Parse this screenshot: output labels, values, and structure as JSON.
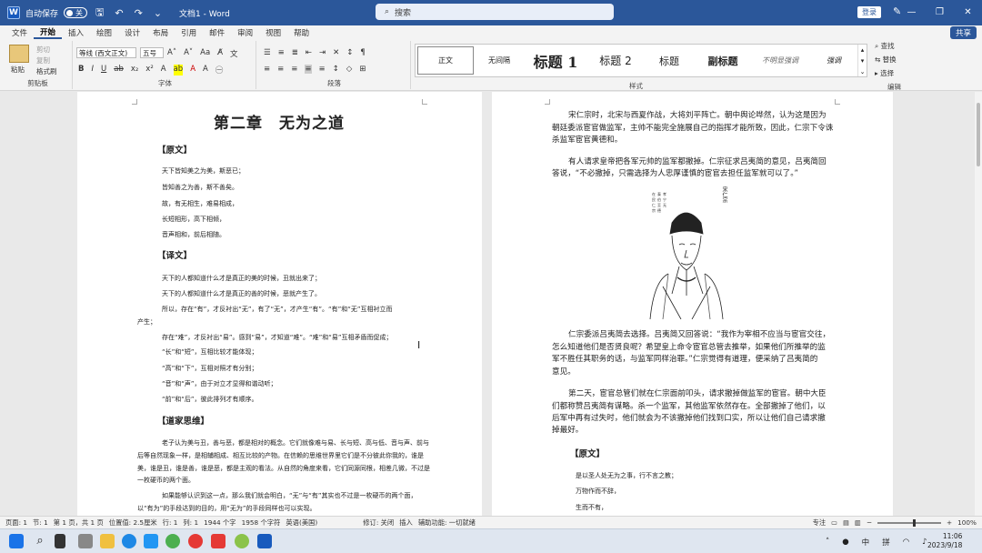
{
  "titlebar": {
    "autosave_label": "自动保存",
    "autosave_state": "关",
    "doc_title": "文档1 - Word",
    "search_placeholder": "搜索",
    "login_label": "登录",
    "minimize": "—",
    "restore": "❐",
    "close": "✕"
  },
  "tabs": [
    "文件",
    "开始",
    "插入",
    "绘图",
    "设计",
    "布局",
    "引用",
    "邮件",
    "审阅",
    "视图",
    "帮助"
  ],
  "share_label": "共享",
  "ribbon": {
    "clipboard": {
      "paste": "粘贴",
      "cut": "剪切",
      "copy": "复制",
      "format_painter": "格式刷",
      "label": "剪贴板"
    },
    "font": {
      "font_name": "等线 (西文正文)",
      "font_size": "五号",
      "label": "字体"
    },
    "paragraph": {
      "label": "段落"
    },
    "styles": {
      "items": [
        "正文",
        "无间隔",
        "标题 1",
        "标题 2",
        "标题",
        "副标题",
        "不明显强调",
        "强调"
      ],
      "label": "样式"
    },
    "editing": {
      "find": "查找",
      "replace": "替换",
      "select": "选择",
      "label": "编辑"
    }
  },
  "page1": {
    "chapter_title": "第二章　无为之道",
    "section_yuanwen": "【原文】",
    "yuanwen_lines": [
      "天下皆知美之为美，斯恶已；",
      "皆知善之为善，斯不善矣。",
      "故，有无相生，难易相成，",
      "长短相形，高下相倾，",
      "音声相和，前后相随。"
    ],
    "section_yiwen": "【译文】",
    "yiwen_lines": [
      "天下的人都知道什么才是真正的美的时候，丑就出来了；",
      "天下的人都知道什么才是真正的善的时候，恶就产生了。",
      "所以，存在“有”，才反衬出“无”，有了“无”，才产生“有”。“有”和“无”互相衬立而",
      "产生；",
      "存在“难”，才反衬出“易”。感到“易”，才知道“难”。“难”和“易”互相矛盾而促成；",
      "“长”和“短”，互相比较才能体现；",
      "“高”和“下”，互相对照才有分别；",
      "“音”和“声”，由于对立才显得和谐动听；",
      "“前”和“后”，彼此排列才有顺序。"
    ],
    "section_sixiang": "【道家思维】",
    "sixiang_lines": [
      "老子认为美与丑，善与恶，都是相对的概念。它们就像难与易、长与短、高与低、音与声、前与",
      "后等自然现象一样，是相辅相成、相互比较的产物。在信赖的思维世界里它们是不分彼此你我的，谁是",
      "美，谁是丑，谁是善，谁是恶，都是主观的看法。从自然的角度来看，它们同源同根，相差几微，不过是",
      "一枚硬币的两个面。",
      "如果能够认识到这一点，那么我们就会明白，“无”与“有”其实也不过是一枚硬币的两个面，",
      "以“有为”的手段达到的目的，用“无为”的手段同样也可以实现。"
    ]
  },
  "page2": {
    "para1": [
      "宋仁宗时，北宋与西夏作战，大将刘平阵亡。朝中舆论哗然，认为这是因为",
      "朝廷委派宦官做监军，主帅不能完全施展自己的指挥才能所致，因此，仁宗下令诛",
      "杀监军宦官黄德和。"
    ],
    "para2": [
      "有人请求皇帝把各军元帅的监军都撤掉。仁宗征求吕夷简的意见，吕夷简回",
      "答说，“不必撤掉，只需选择为人忠厚谨慎的宦官去担任监军就可以了。”"
    ],
    "portrait_caption": "宋仁宗",
    "para3": [
      "仁宗委派吕夷简去选择。吕夷简又回答说：“我作为宰相不应当与宦官交往，",
      "怎么知道他们是否贤良呢？希望皇上命令宦官总管去推举，如果他们所推举的监",
      "军不胜任其职务的话，与监军同样治罪。”仁宗觉得有道理，便采纳了吕夷简的",
      "意见。"
    ],
    "para4": [
      "第二天，宦官总管们就在仁宗面前叩头，请求撤掉做监军的宦官。朝中大臣",
      "们都称赞吕夷简有谋略。杀一个监军，其他监军依然存在。全部撤掉了他们，以",
      "后军中再有过失时，他们就会为不该撤掉他们找到口实，所以让他们自己请求撤",
      "掉最好。"
    ],
    "section_yuanwen": "【原文】",
    "yuanwen_lines": [
      "是以圣人处无为之事，行不言之教；",
      "万物作而不辞，",
      "生而不有，"
    ]
  },
  "statusbar": [
    "页面: 1",
    "节: 1",
    "第 1 页，共 1 页",
    "位置值: 2.5厘米",
    "行: 1",
    "列: 1",
    "1944 个字",
    "1958 个字符",
    "英语(美国)",
    "修订: 关闭",
    "插入",
    "辅助功能: 一切就绪",
    "专注",
    "100%"
  ],
  "tray": {
    "time": "11:06",
    "date": "2023/9/18",
    "lang": "中",
    "ime": "拼"
  }
}
